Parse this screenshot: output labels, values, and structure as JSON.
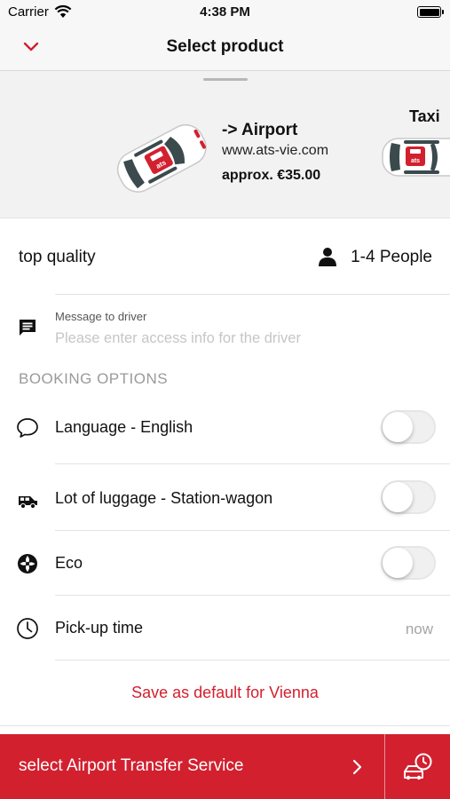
{
  "status_bar": {
    "carrier": "Carrier",
    "time": "4:38 PM"
  },
  "nav": {
    "title": "Select product",
    "back_icon": "chevron-down-icon"
  },
  "products": [
    {
      "name": "-> Airport",
      "website": "www.ats-vie.com",
      "price": "approx. €35.00",
      "badge": "ats"
    },
    {
      "name": "Taxi",
      "badge": "ats"
    }
  ],
  "info": {
    "quality": "top quality",
    "people": "1-4 People"
  },
  "message": {
    "label": "Message to driver",
    "placeholder": "Please enter access info for the driver",
    "value": ""
  },
  "booking": {
    "header": "BOOKING OPTIONS",
    "options": [
      {
        "label": "Language - English",
        "icon": "speech-bubble-icon",
        "enabled": false
      },
      {
        "label": "Lot of luggage - Station-wagon",
        "icon": "station-wagon-icon",
        "enabled": false
      },
      {
        "label": "Eco",
        "icon": "eco-icon",
        "enabled": false
      }
    ],
    "pickup": {
      "label": "Pick-up time",
      "value": "now",
      "icon": "clock-icon"
    }
  },
  "save_default": "Save as default for Vienna",
  "bottom": {
    "select_label": "select Airport Transfer Service",
    "schedule_icon": "scheduled-ride-icon"
  },
  "colors": {
    "accent": "#d2202f",
    "nav_background": "#f7f7f7",
    "carousel_background": "#f2f2f2",
    "placeholder": "#c6c6c6"
  }
}
